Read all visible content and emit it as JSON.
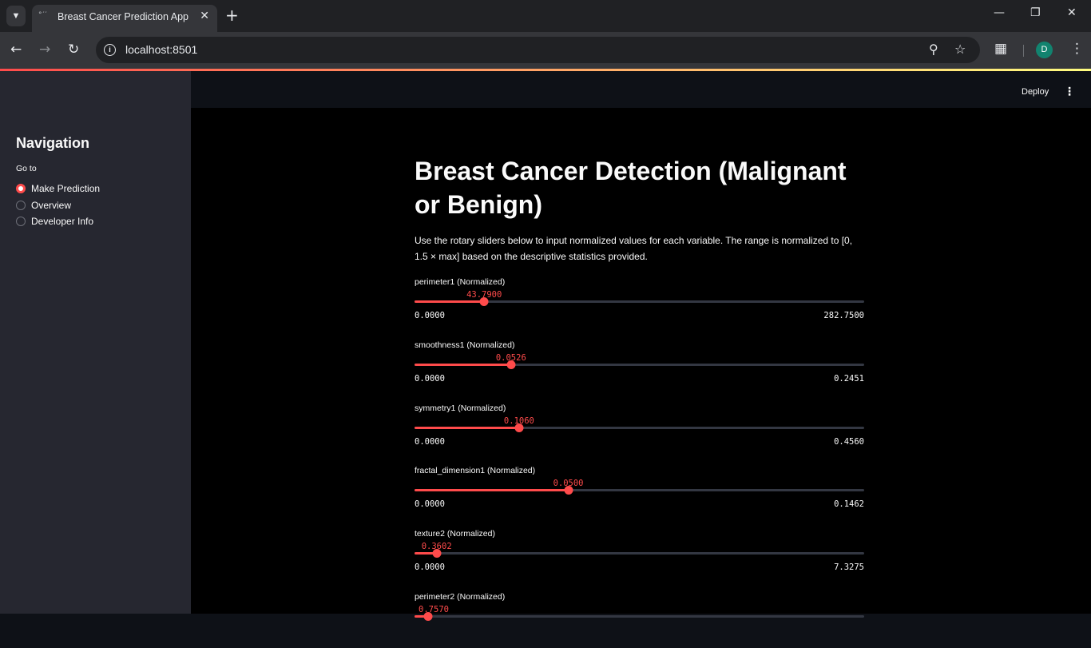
{
  "browser": {
    "tab_title": "Breast Cancer Prediction App",
    "url": "localhost:8501",
    "profile_initial": "D"
  },
  "app": {
    "header": {
      "deploy_label": "Deploy"
    },
    "sidebar": {
      "title": "Navigation",
      "radio_label": "Go to",
      "options": [
        {
          "label": "Make Prediction",
          "selected": true
        },
        {
          "label": "Overview",
          "selected": false
        },
        {
          "label": "Developer Info",
          "selected": false
        }
      ]
    },
    "main": {
      "title": "Breast Cancer Detection (Malignant or Benign)",
      "intro": "Use the rotary sliders below to input normalized values for each variable. The range is normalized to [0, 1.5 × max] based on the descriptive statistics provided.",
      "sliders": [
        {
          "label": "perimeter1 (Normalized)",
          "value": "43.7900",
          "min": "0.0000",
          "max": "282.7500",
          "fraction": 0.1549
        },
        {
          "label": "smoothness1 (Normalized)",
          "value": "0.0526",
          "min": "0.0000",
          "max": "0.2451",
          "fraction": 0.2146
        },
        {
          "label": "symmetry1 (Normalized)",
          "value": "0.1060",
          "min": "0.0000",
          "max": "0.4560",
          "fraction": 0.2325
        },
        {
          "label": "fractal_dimension1 (Normalized)",
          "value": "0.0500",
          "min": "0.0000",
          "max": "0.1462",
          "fraction": 0.342
        },
        {
          "label": "texture2 (Normalized)",
          "value": "0.3602",
          "min": "0.0000",
          "max": "7.3275",
          "fraction": 0.0492
        },
        {
          "label": "perimeter2 (Normalized)",
          "value": "0.7570",
          "min": "",
          "max": "",
          "fraction": 0.03
        }
      ]
    }
  },
  "colors": {
    "accent": "#ff4b4b",
    "sidebar_bg": "#262730",
    "main_bg": "#000000",
    "text": "#fafafa"
  }
}
